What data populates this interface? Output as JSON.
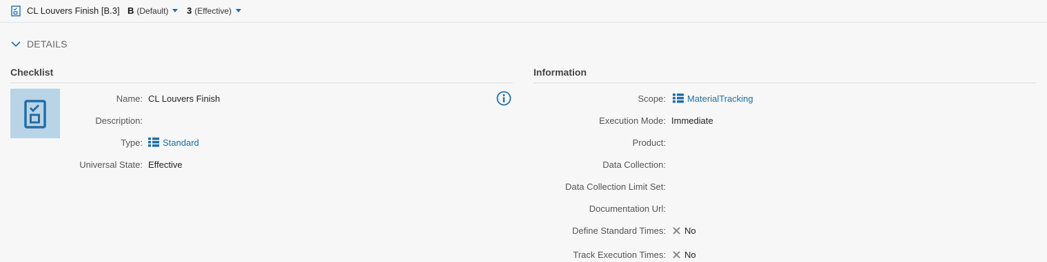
{
  "header": {
    "title": "CL Louvers Finish [B.3]",
    "revision": {
      "value": "B",
      "label": "(Default)"
    },
    "version": {
      "value": "3",
      "label": "(Effective)"
    }
  },
  "details_label": "DETAILS",
  "checklist": {
    "section_title": "Checklist",
    "fields": {
      "name": {
        "label": "Name:",
        "value": "CL Louvers Finish"
      },
      "description": {
        "label": "Description:",
        "value": ""
      },
      "type": {
        "label": "Type:",
        "value": "Standard"
      },
      "universal_state": {
        "label": "Universal State:",
        "value": "Effective"
      }
    }
  },
  "information": {
    "section_title": "Information",
    "fields": {
      "scope": {
        "label": "Scope:",
        "value": "MaterialTracking"
      },
      "execution_mode": {
        "label": "Execution Mode:",
        "value": "Immediate"
      },
      "product": {
        "label": "Product:",
        "value": ""
      },
      "data_collection": {
        "label": "Data Collection:",
        "value": ""
      },
      "data_collection_limit_set": {
        "label": "Data Collection Limit Set:",
        "value": ""
      },
      "documentation_url": {
        "label": "Documentation Url:",
        "value": ""
      },
      "define_standard_times": {
        "label": "Define Standard Times:",
        "value": "No"
      },
      "track_execution_times": {
        "label": "Track Execution Times:",
        "value": "No"
      }
    }
  },
  "colors": {
    "accent": "#1f6ea8",
    "tile": "#b9d4e6",
    "background": "#f7f7f7"
  },
  "icons": [
    "checklist-doc-icon",
    "caret-down-icon",
    "chevron-down-icon",
    "checklist-icon",
    "info-icon",
    "list-icon",
    "x-icon"
  ]
}
